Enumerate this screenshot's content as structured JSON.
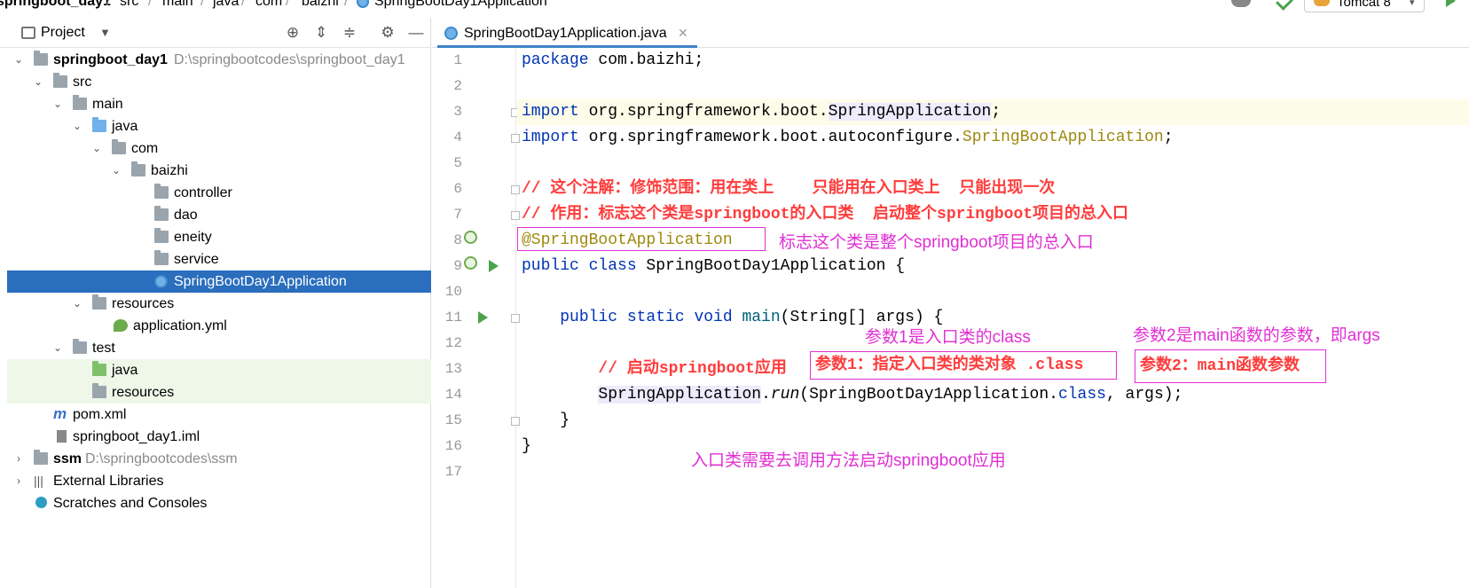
{
  "breadcrumb": {
    "items": [
      "springboot_day1",
      "src",
      "main",
      "java",
      "com",
      "baizhi",
      "SpringBootDay1Application"
    ],
    "separator": "/"
  },
  "toolbar": {
    "run_config": "Tomcat 8"
  },
  "project_panel": {
    "title": "Project",
    "tree": [
      {
        "label": "springboot_day1",
        "path": "D:\\springbootcodes\\springboot_day1"
      },
      {
        "label": "src"
      },
      {
        "label": "main"
      },
      {
        "label": "java"
      },
      {
        "label": "com"
      },
      {
        "label": "baizhi"
      },
      {
        "label": "controller"
      },
      {
        "label": "dao"
      },
      {
        "label": "eneity"
      },
      {
        "label": "service"
      },
      {
        "label": "SpringBootDay1Application"
      },
      {
        "label": "resources"
      },
      {
        "label": "application.yml"
      },
      {
        "label": "test"
      },
      {
        "label": "java"
      },
      {
        "label": "resources"
      },
      {
        "label": "pom.xml"
      },
      {
        "label": "springboot_day1.iml"
      },
      {
        "label": "ssm",
        "path": "D:\\springbootcodes\\ssm"
      },
      {
        "label": "External Libraries"
      },
      {
        "label": "Scratches and Consoles"
      }
    ]
  },
  "editor": {
    "tab_label": "SpringBootDay1Application.java",
    "line_numbers": [
      "1",
      "2",
      "3",
      "4",
      "5",
      "6",
      "7",
      "8",
      "9",
      "10",
      "11",
      "12",
      "13",
      "14",
      "15",
      "16",
      "17"
    ],
    "code": {
      "l1_kw": "package",
      "l1_rest": " com.baizhi;",
      "l3_kw": "import",
      "l3_pkg": " org.springframework.boot.",
      "l3_cls": "SpringApplication",
      "l3_end": ";",
      "l4_kw": "import",
      "l4_pkg": " org.springframework.boot.autoconfigure.",
      "l4_cls": "SpringBootApplication",
      "l4_end": ";",
      "l6": "// 这个注解：修饰范围：用在类上    只能用在入口类上  只能出现一次",
      "l7": "// 作用：标志这个类是springboot的入口类  启动整个springboot项目的总入口",
      "l8": "@SpringBootApplication",
      "l9_kw": "public class",
      "l9_rest": " SpringBootDay1Application {",
      "l11_indent": "    ",
      "l11_kw": "public static void",
      "l11_fn": " main",
      "l11_rest": "(String[] args) {",
      "l13_indent": "        ",
      "l13": "// 启动springboot应用",
      "l14_indent": "        ",
      "l14_cls": "SpringApplication",
      "l14_dot": ".",
      "l14_fn": "run",
      "l14_mid": "(SpringBootDay1Application.",
      "l14_kw": "class",
      "l14_end": ", args);",
      "l15": "    }",
      "l16": "}"
    }
  },
  "annotations": {
    "note_entry": "标志这个类是整个springboot项目的总入口",
    "note_param1_title": "参数1是入口类的class",
    "note_param2_title": "参数2是main函数的参数，即args",
    "box_param1": "参数1：指定入口类的类对象 .class",
    "box_param2": "参数2：main函数参数",
    "note_bottom": "入口类需要去调用方法启动springboot应用",
    "color": "#e02fd3"
  }
}
